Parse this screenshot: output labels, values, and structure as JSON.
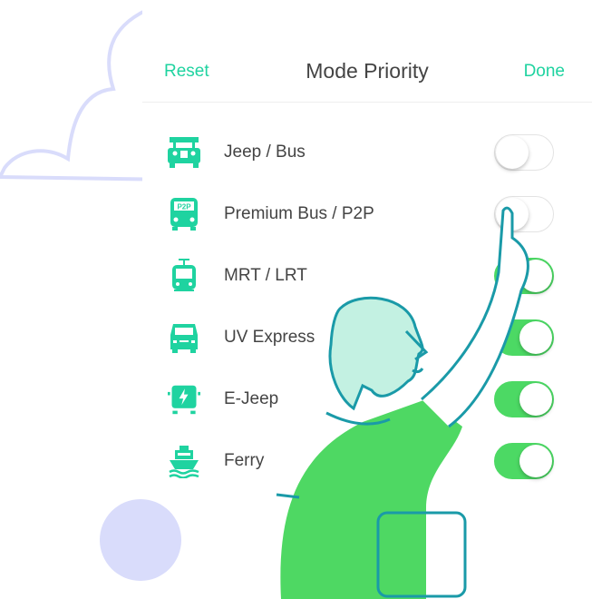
{
  "header": {
    "reset_label": "Reset",
    "title": "Mode Priority",
    "done_label": "Done"
  },
  "modes": [
    {
      "label": "Jeep / Bus",
      "icon": "jeepney-icon",
      "enabled": false
    },
    {
      "label": "Premium Bus / P2P",
      "icon": "p2p-bus-icon",
      "icon_text": "P2P",
      "enabled": false
    },
    {
      "label": "MRT / LRT",
      "icon": "train-icon",
      "enabled": true
    },
    {
      "label": "UV Express",
      "icon": "van-icon",
      "enabled": true
    },
    {
      "label": "E-Jeep",
      "icon": "electric-jeep-icon",
      "enabled": true
    },
    {
      "label": "Ferry",
      "icon": "ferry-icon",
      "enabled": true
    }
  ],
  "colors": {
    "accent": "#1fd3a0",
    "toggle_on": "#4cd964",
    "illustration_outline": "#1a9aa8",
    "cloud": "#d9dcfb"
  }
}
